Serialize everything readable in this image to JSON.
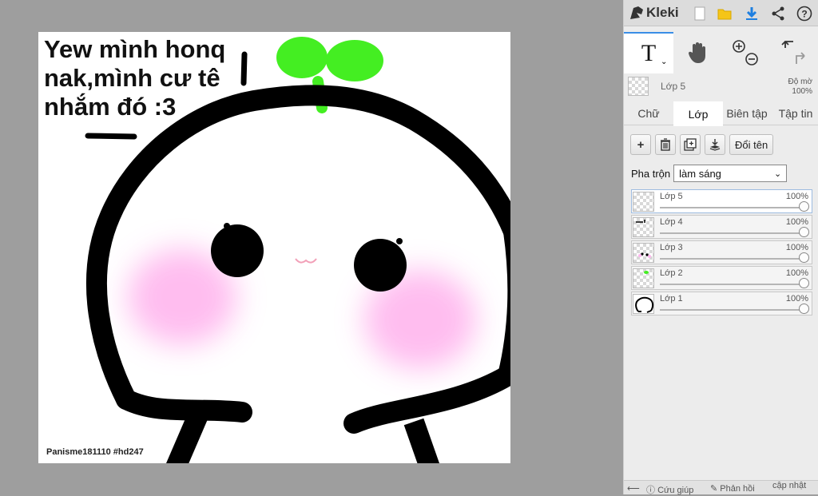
{
  "canvas": {
    "caption": "Yew mình honq\nnak,mình cư tê\nnhắm đó :3",
    "watermark": "Panisme181110 #hd247"
  },
  "app": {
    "name": "Kleki",
    "toolbar_icons": [
      "new-image-icon",
      "open-folder-icon",
      "download-icon",
      "share-icon",
      "help-icon"
    ]
  },
  "tools": {
    "text_tool": "T",
    "icons": [
      "text-tool-icon",
      "hand-tool-icon",
      "zoom-in-icon",
      "zoom-out-icon",
      "undo-icon",
      "redo-icon"
    ]
  },
  "active_layer": {
    "name": "Lớp 5",
    "opacity_label": "Độ mờ",
    "opacity_value": "100%"
  },
  "tabs": [
    "Chữ",
    "Lớp",
    "Biên tập",
    "Tập tin"
  ],
  "layer_panel": {
    "rename_label": "Đổi tên",
    "blend_label": "Pha trộn",
    "blend_value": "làm sáng",
    "layers": [
      {
        "name": "Lớp 5",
        "opacity": "100%"
      },
      {
        "name": "Lớp 4",
        "opacity": "100%"
      },
      {
        "name": "Lớp 3",
        "opacity": "100%"
      },
      {
        "name": "Lớp 2",
        "opacity": "100%"
      },
      {
        "name": "Lớp 1",
        "opacity": "100%"
      }
    ]
  },
  "bottom_bar": {
    "help": "Cứu giúp",
    "feedback": "Phản hồi",
    "update": "cập nhật"
  },
  "colors": {
    "accent": "#3a8ee6",
    "sprout": "#44ee22",
    "blush": "#ffb6ee"
  }
}
